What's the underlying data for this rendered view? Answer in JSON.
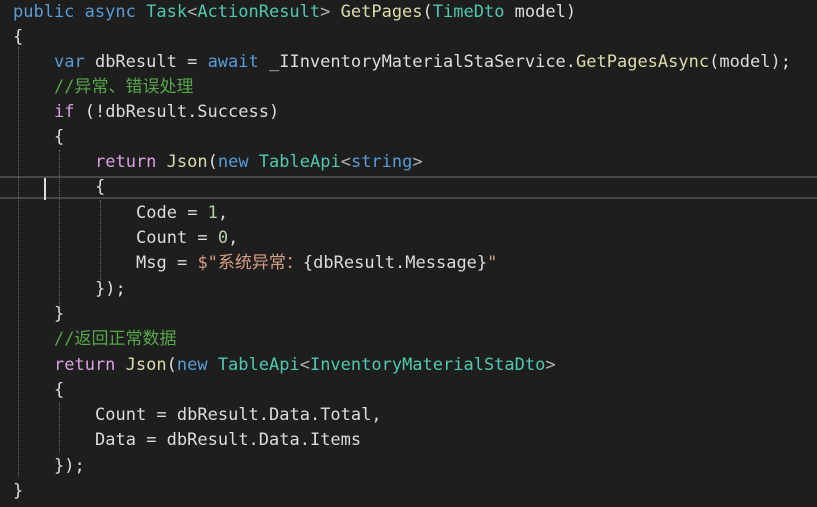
{
  "editor": {
    "line1": {
      "mod1": "public",
      "mod2": "async",
      "task": "Task",
      "lt": "<",
      "result_type": "ActionResult",
      "gt": ">",
      "method": "GetPages",
      "lp": "(",
      "param_type": "TimeDto",
      "param": " model",
      "rp": ")"
    },
    "line2": {
      "brace": "{"
    },
    "line3": {
      "var": "var",
      "name": " dbResult ",
      "eq": "=",
      "await": " await",
      "rest": " _IInventoryMaterialStaService.",
      "method": "GetPagesAsync",
      "args": "(model);"
    },
    "line4": {
      "comment": "//异常、错误处理"
    },
    "line5": {
      "kw": "if",
      "rest": " (!dbResult.Success)"
    },
    "line6": {
      "brace": "{"
    },
    "line7": {
      "ret": "return",
      "json": " Json",
      "lp": "(",
      "new": "new",
      "type": " TableApi",
      "lt": "<",
      "generic": "string",
      "gt": ">"
    },
    "line8": {
      "brace": "{"
    },
    "line9": {
      "prop": "Code",
      "eq": " = ",
      "num": "1",
      "comma": ","
    },
    "line10": {
      "prop": "Count",
      "eq": " = ",
      "num": "0",
      "comma": ","
    },
    "line11": {
      "prop": "Msg",
      "eq": " = ",
      "str1": "$\"系统异常：",
      "interp": "{dbResult.Message}",
      "str2": "\""
    },
    "line12": {
      "close": "});"
    },
    "line13": {
      "brace": "}"
    },
    "line14": {
      "comment": "//返回正常数据"
    },
    "line15": {
      "ret": "return",
      "json": " Json",
      "lp": "(",
      "new": "new",
      "type": " TableApi",
      "lt": "<",
      "generic": "InventoryMaterialStaDto",
      "gt": ">"
    },
    "line16": {
      "brace": "{"
    },
    "line17": {
      "prop": "Count",
      "eq": " = ",
      "rest": "dbResult.Data.Total,"
    },
    "line18": {
      "prop": "Data",
      "eq": " = ",
      "rest": "dbResult.Data.Items"
    },
    "line19": {
      "close": "});"
    },
    "line20": {
      "brace": "}"
    }
  }
}
